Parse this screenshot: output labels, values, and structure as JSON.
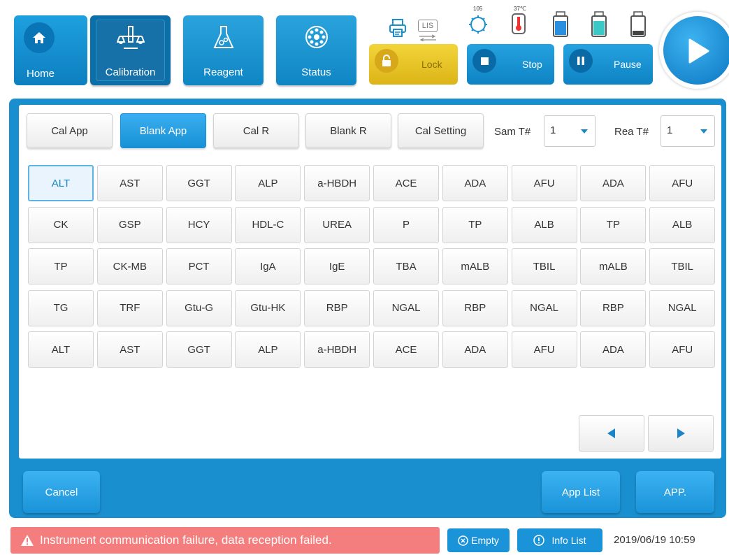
{
  "nav": {
    "home_label": "Home",
    "calibration_label": "Calibration",
    "reagent_label": "Reagent",
    "status_label": "Status",
    "lis_label": "LIS",
    "temp1": "105",
    "temp2": "37℃"
  },
  "controls": {
    "lock_label": "Lock",
    "stop_label": "Stop",
    "pause_label": "Pause"
  },
  "tabs": {
    "cal_app": "Cal App",
    "blank_app": "Blank App",
    "cal_r": "Cal R",
    "blank_r": "Blank R",
    "cal_setting": "Cal Setting",
    "active": "Blank App"
  },
  "filters": {
    "sam_label": "Sam T#",
    "sam_value": "1",
    "rea_label": "Rea T#",
    "rea_value": "1"
  },
  "items": [
    [
      "ALT",
      "AST",
      "GGT",
      "ALP",
      "a-HBDH",
      "ACE",
      "ADA",
      "AFU",
      "ADA",
      "AFU"
    ],
    [
      "CK",
      "GSP",
      "HCY",
      "HDL-C",
      "UREA",
      "P",
      "TP",
      "ALB",
      "TP",
      "ALB"
    ],
    [
      "TP",
      "CK-MB",
      "PCT",
      "IgA",
      "IgE",
      "TBA",
      "mALB",
      "TBIL",
      "mALB",
      "TBIL"
    ],
    [
      "TG",
      "TRF",
      "Gtu-G",
      "Gtu-HK",
      "RBP",
      "NGAL",
      "RBP",
      "NGAL",
      "RBP",
      "NGAL"
    ],
    [
      "ALT",
      "AST",
      "GGT",
      "ALP",
      "a-HBDH",
      "ACE",
      "ADA",
      "AFU",
      "ADA",
      "AFU"
    ]
  ],
  "selected_item": "ALT",
  "footer": {
    "cancel_label": "Cancel",
    "app_list_label": "App List",
    "app_label": "APP."
  },
  "status": {
    "alert_text": "Instrument communication failure, data reception failed.",
    "empty_label": "Empty",
    "info_list_label": "Info List",
    "datetime": "2019/06/19 10:59"
  },
  "colors": {
    "primary": "#1a8fcf",
    "lock": "#e6c21f",
    "alert": "#f47d7d"
  }
}
